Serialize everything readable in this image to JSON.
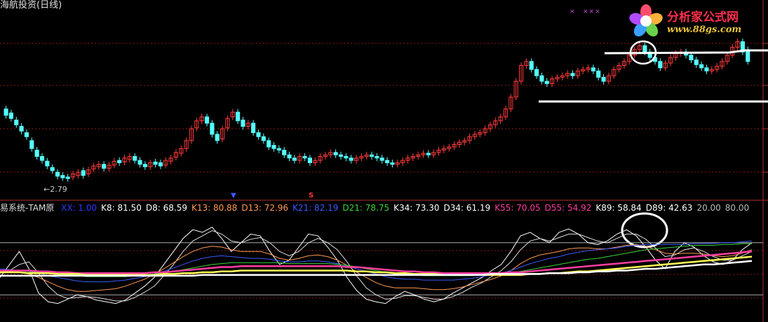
{
  "title": "海航投资(日线)",
  "indicator_name": "易系统-TAM原",
  "low_label": "2.79",
  "top_marks": [
    "×",
    "×××"
  ],
  "signals": {
    "blue": "▼",
    "red": "S"
  },
  "logo": {
    "text": "分析家公式网",
    "url": "www.88gs.com"
  },
  "indicator_values": [
    {
      "label": "XX: 1.00",
      "color": "#2a3cff"
    },
    {
      "label": "K8: 81.50",
      "color": "#ffffff"
    },
    {
      "label": "D8: 68.59",
      "color": "#ffffff"
    },
    {
      "label": "K13: 80.88",
      "color": "#ff9a55"
    },
    {
      "label": "D13: 72.96",
      "color": "#ff9a55"
    },
    {
      "label": "K21: 82.19",
      "color": "#3a5bff"
    },
    {
      "label": "D21: 78.75",
      "color": "#39d43a"
    },
    {
      "label": "K34: 73.30",
      "color": "#ffffff"
    },
    {
      "label": "D34: 61.19",
      "color": "#ffffff"
    },
    {
      "label": "K55: 70.05",
      "color": "#ff3da0"
    },
    {
      "label": "D55: 54.92",
      "color": "#ff3da0"
    },
    {
      "label": "K89: 58.84",
      "color": "#ffffff"
    },
    {
      "label": "D89: 42.63",
      "color": "#ffffff"
    },
    {
      "label": "20.00",
      "color": "#bbbbbb"
    },
    {
      "label": "80.00",
      "color": "#bbbbbb"
    }
  ],
  "chart_data": [
    {
      "type": "candlestick",
      "title": "海航投资(日线)",
      "annotations": [
        "2.79"
      ],
      "closes": [
        3.62,
        3.58,
        3.5,
        3.42,
        3.35,
        3.2,
        3.1,
        3.05,
        2.98,
        2.92,
        2.85,
        2.83,
        2.82,
        2.88,
        2.9,
        2.86,
        2.93,
        2.98,
        3.0,
        2.95,
        2.99,
        3.04,
        3.02,
        3.08,
        3.1,
        3.05,
        3.0,
        2.97,
        3.02,
        3.0,
        2.98,
        3.05,
        3.08,
        3.15,
        3.2,
        3.3,
        3.45,
        3.55,
        3.6,
        3.52,
        3.38,
        3.3,
        3.45,
        3.58,
        3.66,
        3.55,
        3.48,
        3.52,
        3.4,
        3.35,
        3.3,
        3.22,
        3.2,
        3.18,
        3.12,
        3.08,
        3.05,
        3.1,
        3.08,
        3.02,
        3.05,
        3.1,
        3.12,
        3.15,
        3.12,
        3.1,
        3.08,
        3.05,
        3.08,
        3.1,
        3.12,
        3.1,
        3.08,
        3.05,
        3.02,
        3.0,
        3.02,
        3.05,
        3.08,
        3.1,
        3.12,
        3.14,
        3.12,
        3.15,
        3.18,
        3.2,
        3.22,
        3.25,
        3.28,
        3.3,
        3.35,
        3.38,
        3.4,
        3.45,
        3.5,
        3.55,
        3.6,
        3.7,
        3.85,
        4.05,
        4.25,
        4.3,
        4.2,
        4.12,
        4.05,
        4.02,
        4.08,
        4.1,
        4.12,
        4.15,
        4.12,
        4.18,
        4.2,
        4.22,
        4.18,
        4.1,
        4.05,
        4.12,
        4.2,
        4.25,
        4.3,
        4.38,
        4.45,
        4.5,
        4.42,
        4.35,
        4.3,
        4.22,
        4.28,
        4.35,
        4.4,
        4.42,
        4.38,
        4.32,
        4.26,
        4.22,
        4.18,
        4.2,
        4.24,
        4.3,
        4.38,
        4.48,
        4.55,
        4.42,
        4.3
      ],
      "opens": [
        3.7,
        3.65,
        3.56,
        3.48,
        3.4,
        3.3,
        3.18,
        3.1,
        3.04,
        2.96,
        2.9,
        2.86,
        2.84,
        2.84,
        2.86,
        2.92,
        2.88,
        2.94,
        2.97,
        3.0,
        2.95,
        2.99,
        3.05,
        3.03,
        3.06,
        3.1,
        3.05,
        3.0,
        2.97,
        3.03,
        3.02,
        2.99,
        3.04,
        3.09,
        3.14,
        3.2,
        3.3,
        3.46,
        3.55,
        3.6,
        3.52,
        3.38,
        3.32,
        3.46,
        3.6,
        3.66,
        3.56,
        3.48,
        3.52,
        3.4,
        3.35,
        3.3,
        3.24,
        3.2,
        3.18,
        3.12,
        3.08,
        3.05,
        3.1,
        3.08,
        3.02,
        3.05,
        3.1,
        3.12,
        3.15,
        3.12,
        3.1,
        3.08,
        3.05,
        3.08,
        3.1,
        3.12,
        3.1,
        3.08,
        3.05,
        3.02,
        3.0,
        3.02,
        3.05,
        3.08,
        3.1,
        3.12,
        3.14,
        3.12,
        3.15,
        3.18,
        3.2,
        3.22,
        3.25,
        3.28,
        3.3,
        3.35,
        3.38,
        3.4,
        3.45,
        3.5,
        3.55,
        3.6,
        3.7,
        3.85,
        4.05,
        4.25,
        4.3,
        4.2,
        4.12,
        4.05,
        4.02,
        4.08,
        4.1,
        4.12,
        4.15,
        4.12,
        4.18,
        4.2,
        4.22,
        4.18,
        4.1,
        4.05,
        4.12,
        4.2,
        4.25,
        4.3,
        4.38,
        4.45,
        4.5,
        4.42,
        4.35,
        4.3,
        4.22,
        4.28,
        4.35,
        4.4,
        4.42,
        4.38,
        4.32,
        4.26,
        4.22,
        4.18,
        4.2,
        4.24,
        4.3,
        4.38,
        4.48,
        4.55,
        4.45
      ],
      "ylim": [
        2.6,
        4.9
      ],
      "up_color": "#ff3b3b",
      "down_color": "#54ffff"
    },
    {
      "type": "line",
      "title": "易系统-TAM原",
      "ylim": [
        0,
        100
      ],
      "reference_lines": [
        20,
        80
      ],
      "series": [
        {
          "name": "K8",
          "color": "#ffffff",
          "values": [
            40,
            55,
            70,
            50,
            22,
            12,
            10,
            15,
            20,
            18,
            14,
            12,
            10,
            14,
            22,
            30,
            40,
            55,
            70,
            85,
            95,
            92,
            98,
            85,
            70,
            80,
            90,
            88,
            70,
            55,
            60,
            75,
            90,
            88,
            75,
            60,
            40,
            25,
            15,
            12,
            10,
            18,
            24,
            20,
            15,
            12,
            15,
            22,
            28,
            34,
            40,
            48,
            55,
            70,
            88,
            92,
            85,
            80,
            92,
            96,
            90,
            80,
            78,
            82,
            90,
            95,
            88,
            75,
            60,
            50,
            70,
            80,
            75,
            65,
            58,
            55,
            60,
            72,
            80
          ]
        },
        {
          "name": "D8",
          "color": "#dddddd",
          "values": [
            45,
            48,
            55,
            58,
            45,
            30,
            20,
            16,
            17,
            18,
            17,
            15,
            13,
            13,
            17,
            23,
            30,
            42,
            55,
            70,
            82,
            88,
            94,
            90,
            82,
            80,
            84,
            86,
            80,
            70,
            65,
            70,
            80,
            85,
            80,
            72,
            58,
            42,
            28,
            20,
            15,
            16,
            19,
            19,
            17,
            15,
            15,
            18,
            23,
            29,
            34,
            41,
            48,
            58,
            72,
            82,
            85,
            82,
            86,
            90,
            90,
            86,
            82,
            80,
            85,
            90,
            90,
            84,
            74,
            64,
            66,
            72,
            74,
            70,
            64,
            60,
            60,
            65,
            70
          ]
        },
        {
          "name": "K13",
          "color": "#ff9a55",
          "values": [
            48,
            47,
            46,
            44,
            40,
            35,
            30,
            26,
            24,
            24,
            25,
            26,
            27,
            30,
            34,
            38,
            44,
            50,
            57,
            64,
            70,
            74,
            76,
            75,
            72,
            70,
            70,
            70,
            67,
            62,
            60,
            62,
            65,
            66,
            64,
            60,
            54,
            46,
            40,
            34,
            30,
            28,
            28,
            28,
            27,
            26,
            26,
            27,
            29,
            32,
            35,
            38,
            42,
            48,
            56,
            62,
            66,
            68,
            70,
            73,
            74,
            74,
            73,
            73,
            75,
            77,
            78,
            76,
            72,
            68,
            67,
            68,
            68,
            67,
            65,
            64,
            65,
            68,
            72
          ]
        },
        {
          "name": "K21",
          "color": "#3a5bff",
          "values": [
            50,
            49,
            48,
            47,
            45,
            42,
            40,
            38,
            36,
            35,
            35,
            35,
            36,
            37,
            39,
            41,
            44,
            47,
            51,
            55,
            59,
            62,
            64,
            65,
            64,
            63,
            62,
            62,
            61,
            59,
            58,
            58,
            59,
            59,
            58,
            56,
            53,
            50,
            47,
            44,
            41,
            39,
            38,
            38,
            37,
            37,
            37,
            37,
            38,
            39,
            41,
            43,
            45,
            48,
            52,
            56,
            59,
            62,
            64,
            67,
            69,
            71,
            72,
            73,
            74,
            76,
            77,
            78,
            78,
            78,
            78,
            78,
            79,
            79,
            79,
            80,
            80,
            81,
            82
          ]
        },
        {
          "name": "K34",
          "color": "#39d43a",
          "values": [
            48,
            48,
            48,
            47,
            46,
            45,
            44,
            43,
            42,
            41,
            41,
            41,
            41,
            41,
            42,
            43,
            44,
            45,
            47,
            49,
            51,
            53,
            55,
            56,
            57,
            57,
            57,
            57,
            57,
            57,
            56,
            56,
            56,
            56,
            56,
            55,
            54,
            52,
            50,
            48,
            46,
            45,
            44,
            43,
            42,
            42,
            42,
            42,
            42,
            42,
            43,
            43,
            44,
            45,
            47,
            49,
            51,
            53,
            55,
            57,
            59,
            61,
            62,
            64,
            66,
            68,
            70,
            72,
            73,
            74,
            75,
            76,
            77,
            77,
            77,
            78,
            78,
            79,
            79
          ]
        },
        {
          "name": "K55",
          "color": "#ff3da0",
          "values": [
            48,
            48,
            48,
            48,
            47,
            47,
            46,
            46,
            45,
            45,
            45,
            45,
            45,
            45,
            45,
            45,
            46,
            46,
            47,
            48,
            49,
            50,
            51,
            52,
            52,
            53,
            53,
            53,
            53,
            53,
            53,
            53,
            53,
            53,
            53,
            53,
            52,
            52,
            51,
            50,
            49,
            48,
            47,
            47,
            46,
            46,
            45,
            45,
            45,
            45,
            45,
            45,
            45,
            46,
            46,
            47,
            48,
            49,
            50,
            51,
            52,
            53,
            54,
            55,
            56,
            57,
            58,
            59,
            60,
            61,
            62,
            63,
            64,
            65,
            66,
            67,
            68,
            69,
            70
          ]
        },
        {
          "name": "D55",
          "color": "#ffff55",
          "values": [
            46,
            46,
            46,
            45,
            45,
            45,
            44,
            44,
            44,
            43,
            43,
            43,
            43,
            43,
            43,
            43,
            43,
            44,
            44,
            45,
            45,
            46,
            46,
            47,
            47,
            48,
            48,
            48,
            48,
            48,
            48,
            48,
            48,
            48,
            48,
            48,
            48,
            47,
            47,
            46,
            46,
            45,
            45,
            44,
            44,
            44,
            43,
            43,
            43,
            43,
            43,
            43,
            43,
            43,
            43,
            44,
            44,
            45,
            45,
            46,
            47,
            47,
            48,
            49,
            50,
            51,
            52,
            53,
            54,
            55,
            56,
            57,
            58,
            59,
            60,
            61,
            62,
            63,
            64
          ]
        },
        {
          "name": "K89",
          "color": "#ffffff",
          "values": [
            42,
            42,
            42,
            42,
            42,
            42,
            42,
            42,
            42,
            42,
            42,
            42,
            42,
            42,
            42,
            42,
            42,
            42,
            42,
            42,
            42,
            43,
            43,
            43,
            43,
            43,
            43,
            43,
            43,
            43,
            43,
            43,
            43,
            43,
            43,
            43,
            43,
            43,
            43,
            43,
            43,
            43,
            43,
            43,
            43,
            43,
            43,
            43,
            43,
            43,
            43,
            44,
            44,
            44,
            44,
            44,
            44,
            45,
            45,
            45,
            46,
            46,
            47,
            47,
            48,
            48,
            49,
            50,
            50,
            51,
            52,
            53,
            54,
            55,
            55,
            56,
            57,
            58,
            59
          ]
        }
      ]
    }
  ]
}
